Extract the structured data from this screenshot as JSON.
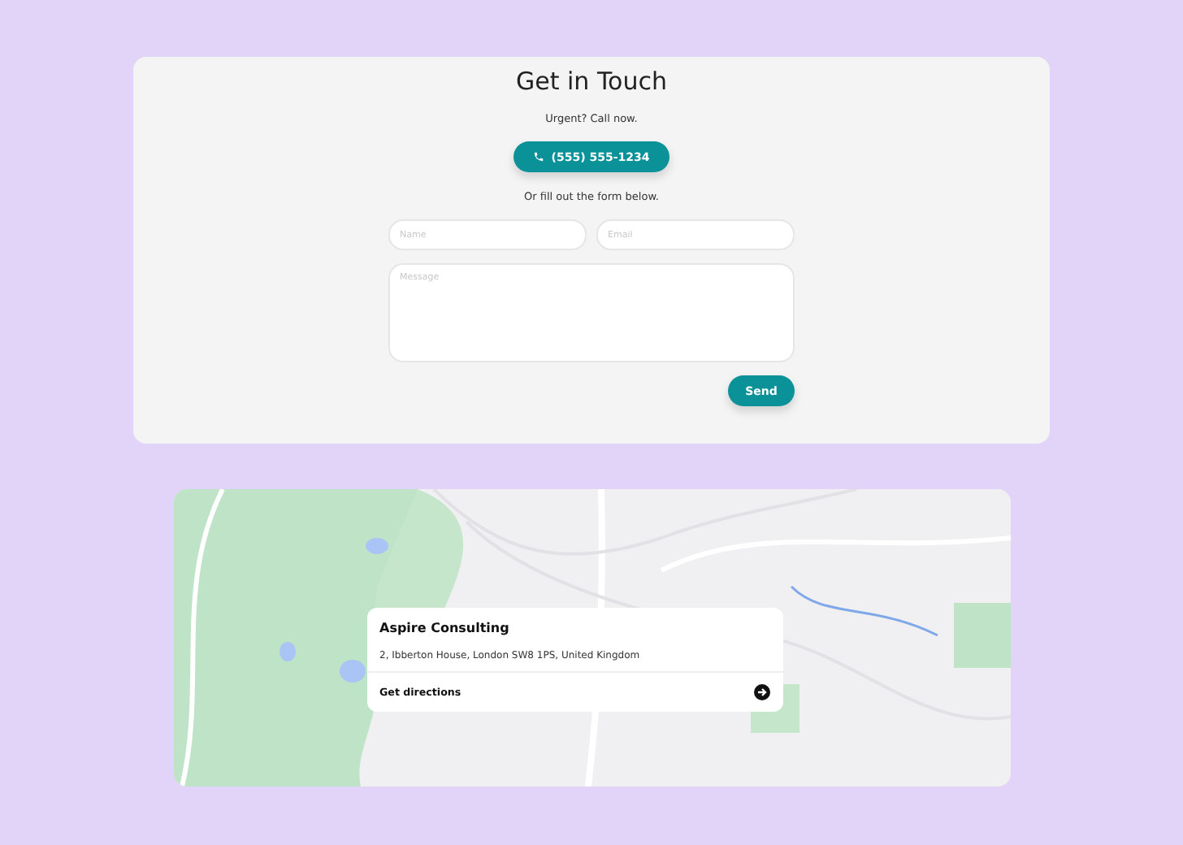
{
  "contact": {
    "title": "Get in Touch",
    "urgent_text": "Urgent? Call now.",
    "phone_button": "(555) 555-1234",
    "or_text": "Or fill out the form below.",
    "fields": [
      {
        "placeholder": "Name"
      },
      {
        "placeholder": "Email"
      }
    ],
    "message": {
      "placeholder": "Message"
    },
    "send_button": "Send"
  },
  "map": {
    "kind": "picture",
    "place": {
      "name": "Aspire Consulting",
      "address": "2, Ibberton House, London SW8 1PS, United Kingdom",
      "directions_link": "Get directions"
    }
  }
}
